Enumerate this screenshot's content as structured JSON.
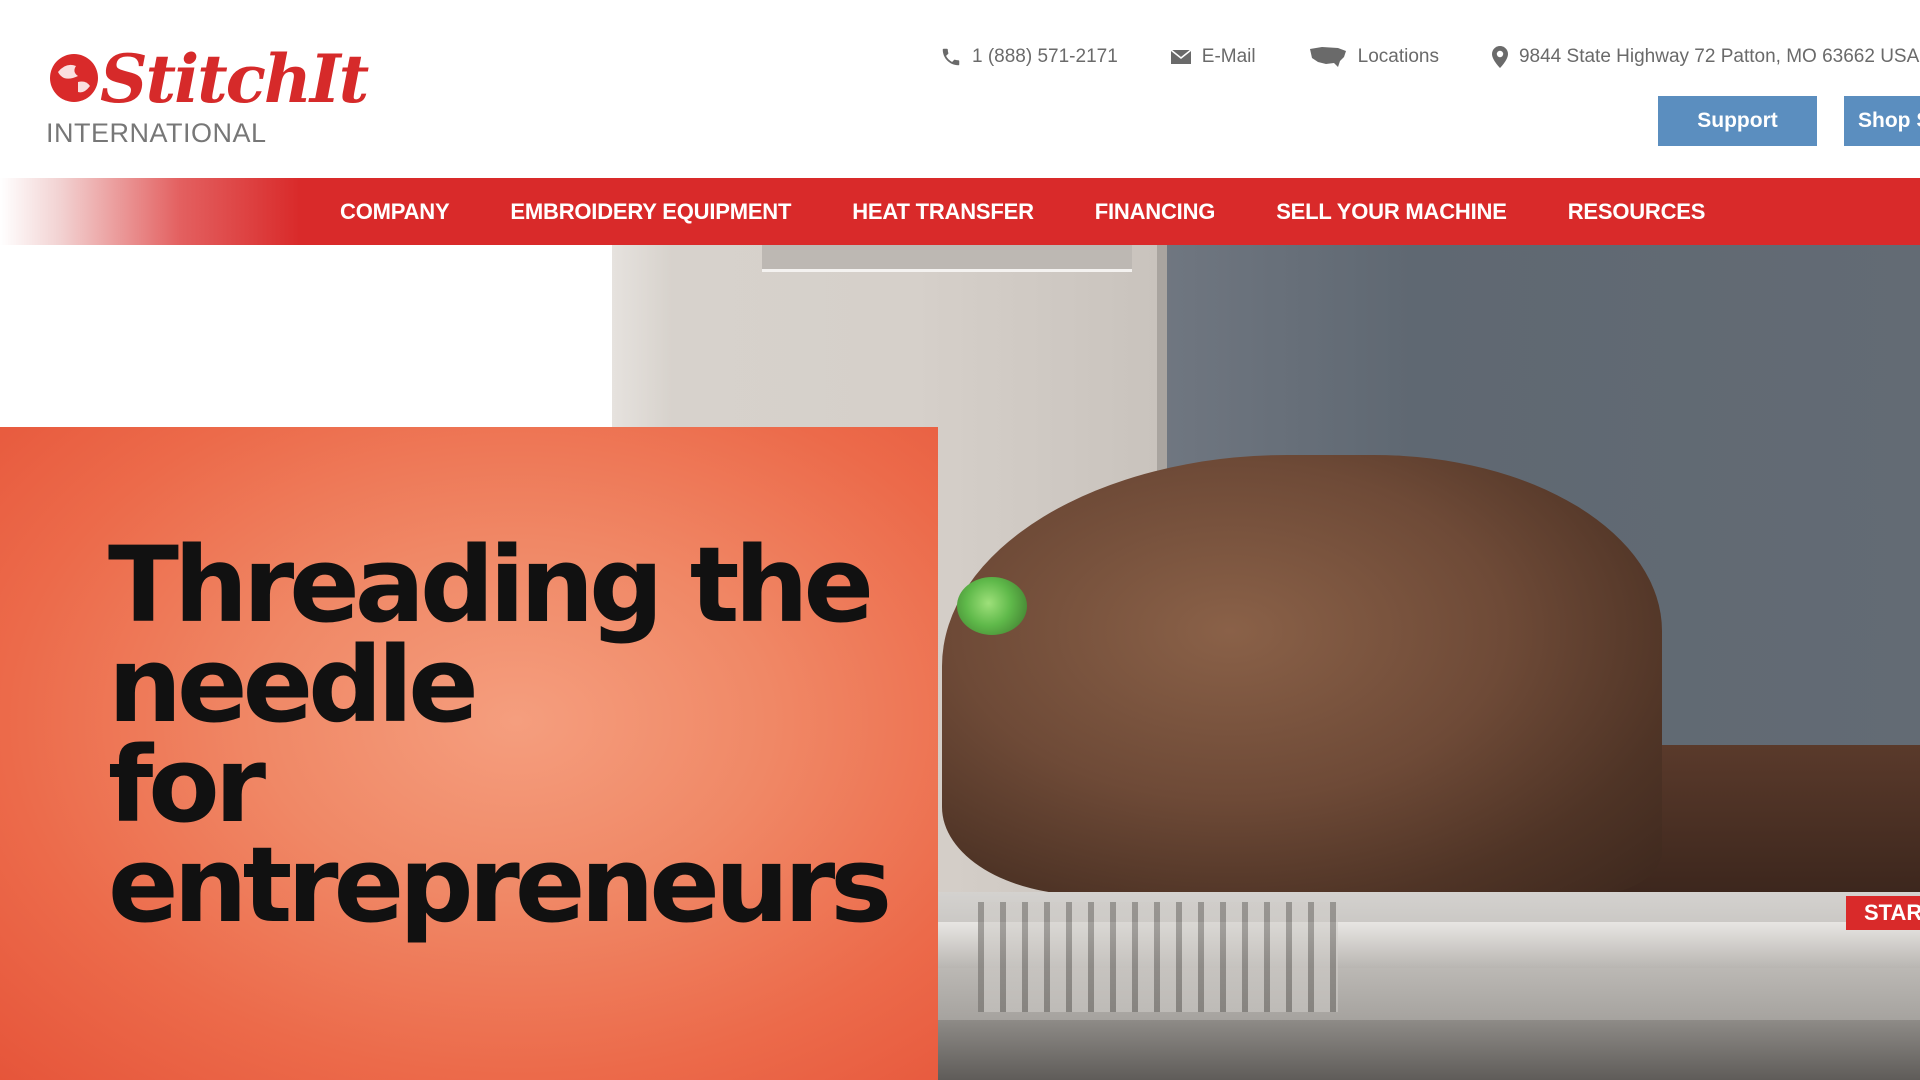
{
  "brand": {
    "name_script": "StitchIt",
    "name_sub": "INTERNATIONAL",
    "colors": {
      "red": "#d92a2a",
      "button_blue": "#5b8ebf",
      "text_gray": "#6a6a6a",
      "hero_orange": "#ec6a4a"
    }
  },
  "topbar": {
    "phone": {
      "icon": "phone-icon",
      "label": "1 (888) 571-2171"
    },
    "email": {
      "icon": "mail-icon",
      "label": "E-Mail"
    },
    "locations": {
      "icon": "usa-map-icon",
      "label": "Locations"
    },
    "address": {
      "icon": "map-pin-icon",
      "label": "9844 State Highway 72 Patton, MO 63662 USA"
    }
  },
  "buttons": {
    "support": "Support",
    "shop": "Shop S"
  },
  "nav": {
    "items": [
      {
        "label": "COMPANY"
      },
      {
        "label": "EMBROIDERY EQUIPMENT"
      },
      {
        "label": "HEAT TRANSFER"
      },
      {
        "label": "FINANCING"
      },
      {
        "label": "SELL YOUR MACHINE"
      },
      {
        "label": "RESOURCES"
      }
    ]
  },
  "hero": {
    "title_lines": [
      "Threading the",
      "needle",
      "for",
      "entrepreneurs"
    ],
    "badge": "STAR"
  }
}
